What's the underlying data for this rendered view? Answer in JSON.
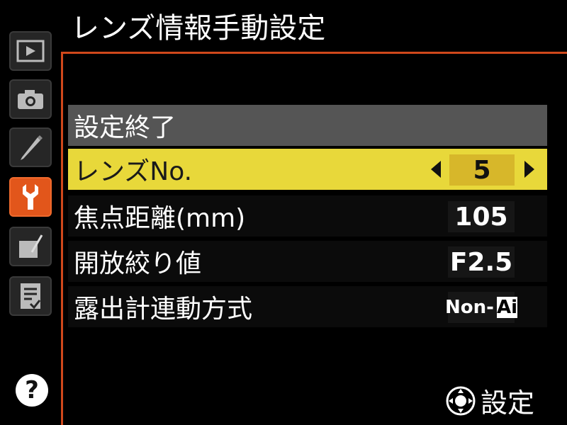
{
  "header": {
    "title": "レンズ情報手動設定"
  },
  "menu": {
    "tabs": [
      {
        "name": "playback-menu",
        "icon": "playback-icon"
      },
      {
        "name": "shooting-menu",
        "icon": "camera-icon"
      },
      {
        "name": "custom-settings-menu",
        "icon": "pencil-icon"
      },
      {
        "name": "setup-menu",
        "icon": "wrench-icon",
        "active": true
      },
      {
        "name": "retouch-menu",
        "icon": "retouch-icon"
      },
      {
        "name": "my-menu",
        "icon": "recent-settings-icon"
      }
    ],
    "help_label": "?"
  },
  "rows": {
    "done": {
      "label": "設定終了"
    },
    "lens_no": {
      "label": "レンズNo.",
      "value": "5"
    },
    "focal_length": {
      "label": "焦点距離(mm)",
      "value": "105"
    },
    "max_aperture": {
      "label": "開放絞り値",
      "value": "F2.5"
    },
    "metering_coupling": {
      "label": "露出計連動方式",
      "value": "Non-",
      "value_icon": "Ai"
    }
  },
  "footer": {
    "hint_label": "設定",
    "hint_icon": "multi-selector-icon"
  },
  "colors": {
    "accent": "#d0481b",
    "selected": "#e8d83a",
    "header_row": "#555555"
  }
}
